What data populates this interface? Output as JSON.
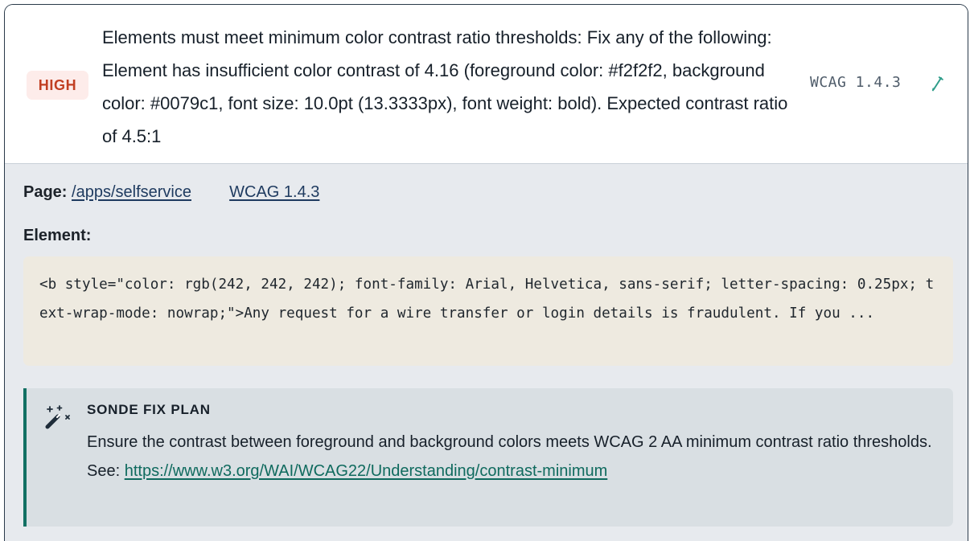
{
  "issue": {
    "severity": "HIGH",
    "message": "Elements must meet minimum color contrast ratio thresholds: Fix any of the following: Element has insufficient color contrast of 4.16 (foreground color: #f2f2f2, background color: #0079c1, font size: 10.0pt (13.3333px), font weight: bold). Expected contrast ratio of 4.5:1",
    "wcag_tag": "WCAG 1.4.3",
    "edit_icon": "pencil-icon"
  },
  "details": {
    "page_label": "Page:",
    "page_link": "/apps/selfservice",
    "wcag_link": "WCAG 1.4.3",
    "element_label": "Element:",
    "element_code": "<b style=\"color: rgb(242, 242, 242); font-family: Arial, Helvetica, sans-serif; letter-spacing: 0.25px; text-wrap-mode: nowrap;\">Any request for a wire transfer or login details is fraudulent. If you ..."
  },
  "fix_plan": {
    "icon": "magic-wand-icon",
    "title": "SONDE FIX PLAN",
    "text": "Ensure the contrast between foreground and background colors meets WCAG 2 AA minimum contrast ratio thresholds. See: ",
    "link": "https://www.w3.org/WAI/WCAG22/Understanding/contrast-minimum"
  },
  "colors": {
    "severity_high_text": "#c13f22",
    "severity_high_bg": "#fdecea",
    "accent_teal": "#127063",
    "link_navy": "#1e3a5f",
    "code_bg": "#eeeae0",
    "fix_bg": "#d9dfe3"
  }
}
